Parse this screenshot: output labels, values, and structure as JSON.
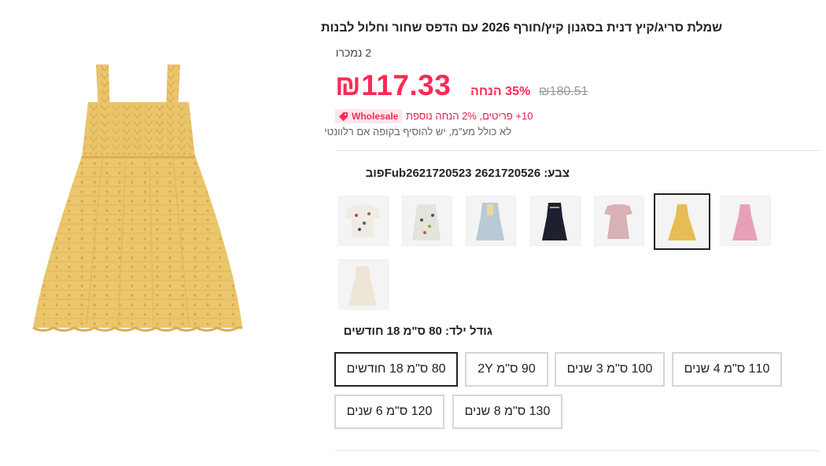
{
  "product": {
    "title": "שמלת סריג/קיץ דנית בסגנון קיץ/חורף 2026 עם הדפס שחור וחלול לבנות",
    "sold": "2 נמכרו",
    "price": "₪117.33",
    "discount": "35% הנחה",
    "original_price": "₪180.51",
    "wholesale_badge": "Wholesale",
    "wholesale_text": "10+ פריטים, 2% הנחה נוספת",
    "vat_note": "לא כולל מע\"מ, יש להוסיף בקופה אם רלוונטי",
    "main_image_icon": "yellow-knit-dress-image"
  },
  "color": {
    "label": "צבע: Fub2621720523 2621720526פוב",
    "swatches": [
      {
        "name": "pink-dress",
        "selected": false,
        "color": "#e7a0b8"
      },
      {
        "name": "yellow-dress",
        "selected": true,
        "color": "#e6bd55"
      },
      {
        "name": "pink-tshirt-dress",
        "selected": false,
        "color": "#d8b0b5"
      },
      {
        "name": "black-dress",
        "selected": false,
        "color": "#1e2030"
      },
      {
        "name": "light-blue-dress",
        "selected": false,
        "color": "#b8cad6"
      },
      {
        "name": "white-print-dress",
        "selected": false,
        "color": "#e4e4dc"
      },
      {
        "name": "white-print-shirt",
        "selected": false,
        "color": "#f0ece4"
      },
      {
        "name": "cream-dress",
        "selected": false,
        "color": "#ede6d6"
      }
    ]
  },
  "size": {
    "label": "גודל ילד: 80 ס\"מ 18 חודשים",
    "options": [
      {
        "label": "110 ס\"מ 4 שנים",
        "selected": false
      },
      {
        "label": "100 ס\"מ 3 שנים",
        "selected": false
      },
      {
        "label": "90 ס\"מ 2Y",
        "selected": false
      },
      {
        "label": "80 ס\"מ 18 חודשים",
        "selected": true
      },
      {
        "label": "130 ס\"מ 8 שנים",
        "selected": false
      },
      {
        "label": "120 ס\"מ 6 שנים",
        "selected": false
      }
    ]
  }
}
